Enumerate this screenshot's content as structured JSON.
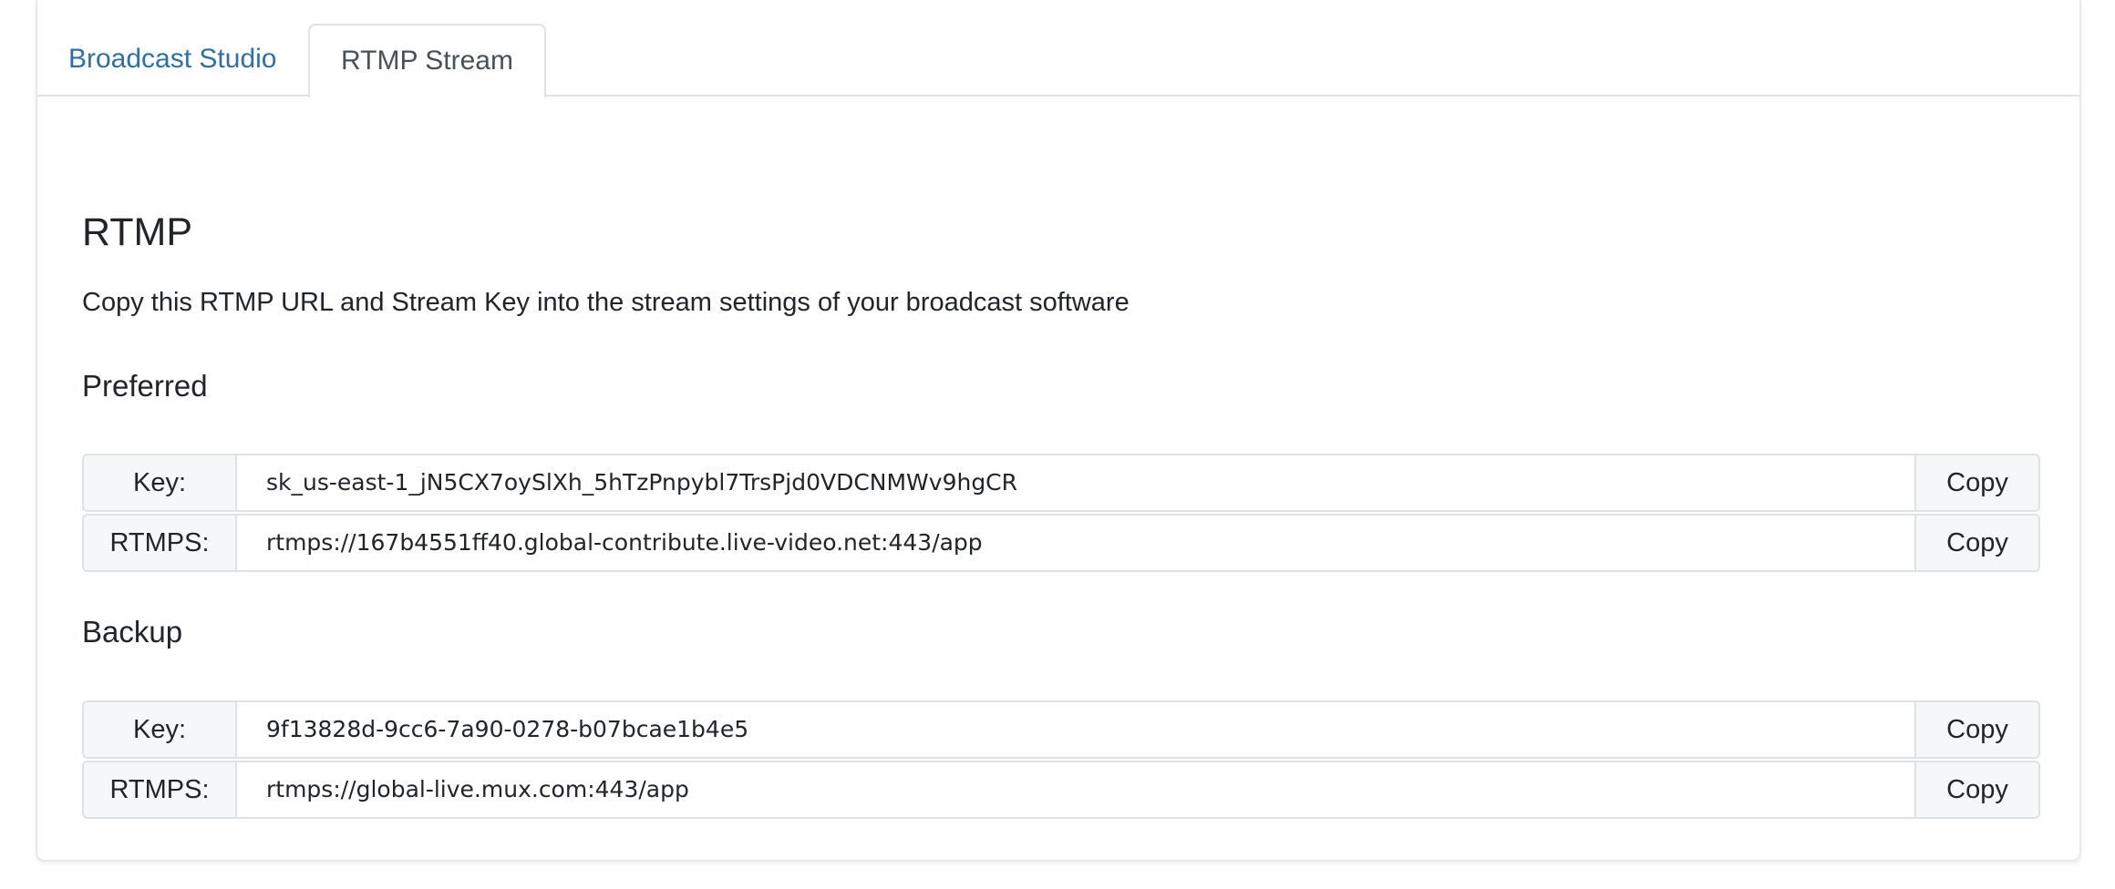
{
  "tabs": [
    {
      "label": "Broadcast Studio",
      "active": false
    },
    {
      "label": "RTMP Stream",
      "active": true
    }
  ],
  "section": {
    "title": "RTMP",
    "description": "Copy this RTMP URL and Stream Key into the stream settings of your broadcast software"
  },
  "preferred": {
    "heading": "Preferred",
    "rows": [
      {
        "label": "Key:",
        "value": "sk_us-east-1_jN5CX7oySlXh_5hTzPnpybl7TrsPjd0VDCNMWv9hgCR",
        "copy_label": "Copy"
      },
      {
        "label": "RTMPS:",
        "value": "rtmps://167b4551ff40.global-contribute.live-video.net:443/app",
        "copy_label": "Copy"
      }
    ]
  },
  "backup": {
    "heading": "Backup",
    "rows": [
      {
        "label": "Key:",
        "value": "9f13828d-9cc6-7a90-0278-b07bcae1b4e5",
        "copy_label": "Copy"
      },
      {
        "label": "RTMPS:",
        "value": "rtmps://global-live.mux.com:443/app",
        "copy_label": "Copy"
      }
    ]
  },
  "colors": {
    "link": "#2f6fa8",
    "text": "#212529",
    "border": "#dee2e6",
    "label_bg": "#f6f7f9"
  }
}
